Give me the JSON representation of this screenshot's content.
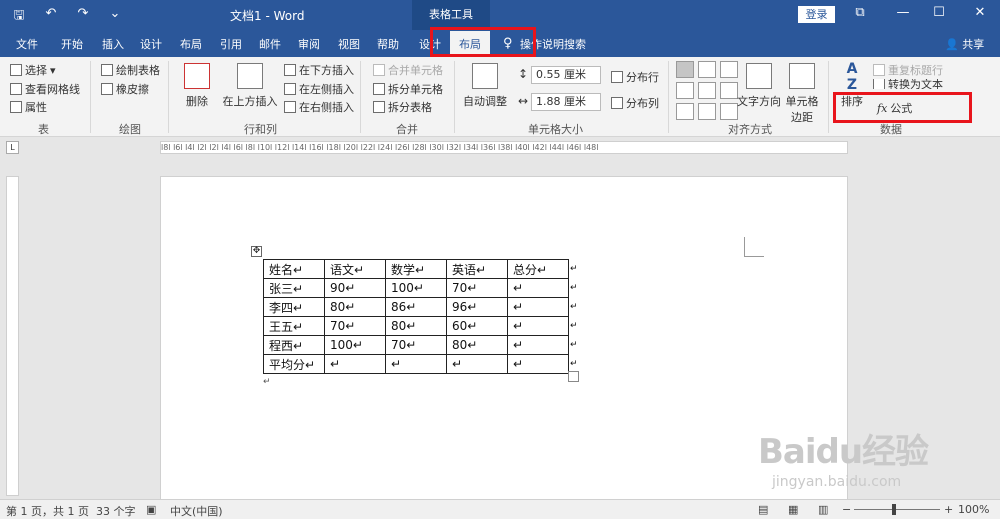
{
  "titlebar": {
    "doc_title": "文档1  -  Word",
    "context_tab": "表格工具",
    "login": "登录"
  },
  "tabs": [
    "文件",
    "开始",
    "插入",
    "设计",
    "布局",
    "引用",
    "邮件",
    "审阅",
    "视图",
    "帮助",
    "设计"
  ],
  "tab_active": "布局",
  "tell_me": "操作说明搜索",
  "share": "共享",
  "ribbon": {
    "table_group": {
      "select": "选择",
      "gridlines": "查看网格线",
      "properties": "属性",
      "label": "表"
    },
    "draw_group": {
      "draw_table": "绘制表格",
      "eraser": "橡皮擦",
      "label": "绘图"
    },
    "rows_cols": {
      "delete": "删除",
      "insert_above": "在上方插入",
      "insert_below": "在下方插入",
      "insert_left": "在左侧插入",
      "insert_right": "在右侧插入",
      "label": "行和列"
    },
    "merge": {
      "merge_cells": "合并单元格",
      "split_cells": "拆分单元格",
      "split_table": "拆分表格",
      "label": "合并"
    },
    "cell_size": {
      "autofit": "自动调整",
      "height": "0.55 厘米",
      "width": "1.88 厘米",
      "dist_rows": "分布行",
      "dist_cols": "分布列",
      "label": "单元格大小"
    },
    "alignment": {
      "text_direction": "文字方向",
      "cell_margins_1": "单元格",
      "cell_margins_2": "边距",
      "label": "对齐方式"
    },
    "data": {
      "sort": "排序",
      "repeat_header": "重复标题行",
      "convert_text": "转换为文本",
      "formula": "公式",
      "label": "数据"
    }
  },
  "ruler_marks": "l8l  l6l  l4l  l2l      l2l  l4l  l6l  l8l  l10l l12l l14l l16l l18l l20l l22l l24l l26l l28l l30l l32l l34l l36l l38l l40l l42l l44l l46l l48l",
  "table": {
    "rows": [
      [
        "姓名↵",
        "语文↵",
        "数学↵",
        "英语↵",
        "总分↵"
      ],
      [
        "张三↵",
        "90↵",
        "100↵",
        "70↵",
        "↵"
      ],
      [
        "李四↵",
        "80↵",
        "86↵",
        "96↵",
        "↵"
      ],
      [
        "王五↵",
        "70↵",
        "80↵",
        "60↵",
        "↵"
      ],
      [
        "程西↵",
        "100↵",
        "70↵",
        "80↵",
        "↵"
      ],
      [
        "平均分↵",
        "↵",
        "↵",
        "↵",
        "↵"
      ]
    ],
    "row_end_mark": "↵",
    "para_mark": "↵"
  },
  "status": {
    "page": "第 1 页，共 1 页",
    "words": "33 个字",
    "language": "中文(中国)",
    "zoom": "100%"
  },
  "watermark": {
    "logo": "Baidu经验",
    "url": "jingyan.baidu.com"
  },
  "colors": {
    "title_blue": "#2b579a",
    "highlight_red": "#e8141b"
  }
}
